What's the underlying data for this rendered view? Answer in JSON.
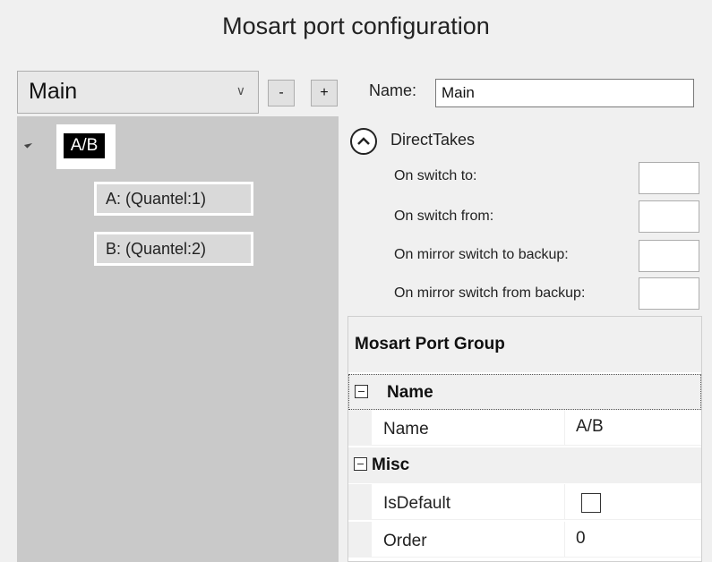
{
  "title": "Mosart port configuration",
  "selector": {
    "value": "Main",
    "arrow_icon": "chevron-down-icon",
    "remove_label": "-",
    "add_label": "+"
  },
  "tree": {
    "root": {
      "label": "A/B",
      "expander_icon": "expanded-triangle-icon",
      "children": [
        {
          "label": "A: (Quantel:1)"
        },
        {
          "label": "B: (Quantel:2)"
        }
      ]
    }
  },
  "name_field": {
    "label": "Name:",
    "value": "Main"
  },
  "direct_takes": {
    "title": "DirectTakes",
    "toggle_icon": "chevron-up-circle-icon",
    "rows": [
      {
        "label": "On switch to:",
        "value": ""
      },
      {
        "label": "On switch from:",
        "value": ""
      },
      {
        "label": "On mirror switch to backup:",
        "value": ""
      },
      {
        "label": "On mirror switch from backup:",
        "value": ""
      }
    ]
  },
  "property_grid": {
    "header": "Mosart Port Group",
    "categories": [
      {
        "name": "Name",
        "properties": [
          {
            "name": "Name",
            "value": "A/B"
          }
        ]
      },
      {
        "name": "Misc",
        "properties": [
          {
            "name": "IsDefault",
            "value": false
          },
          {
            "name": "Order",
            "value": "0"
          }
        ]
      }
    ]
  }
}
